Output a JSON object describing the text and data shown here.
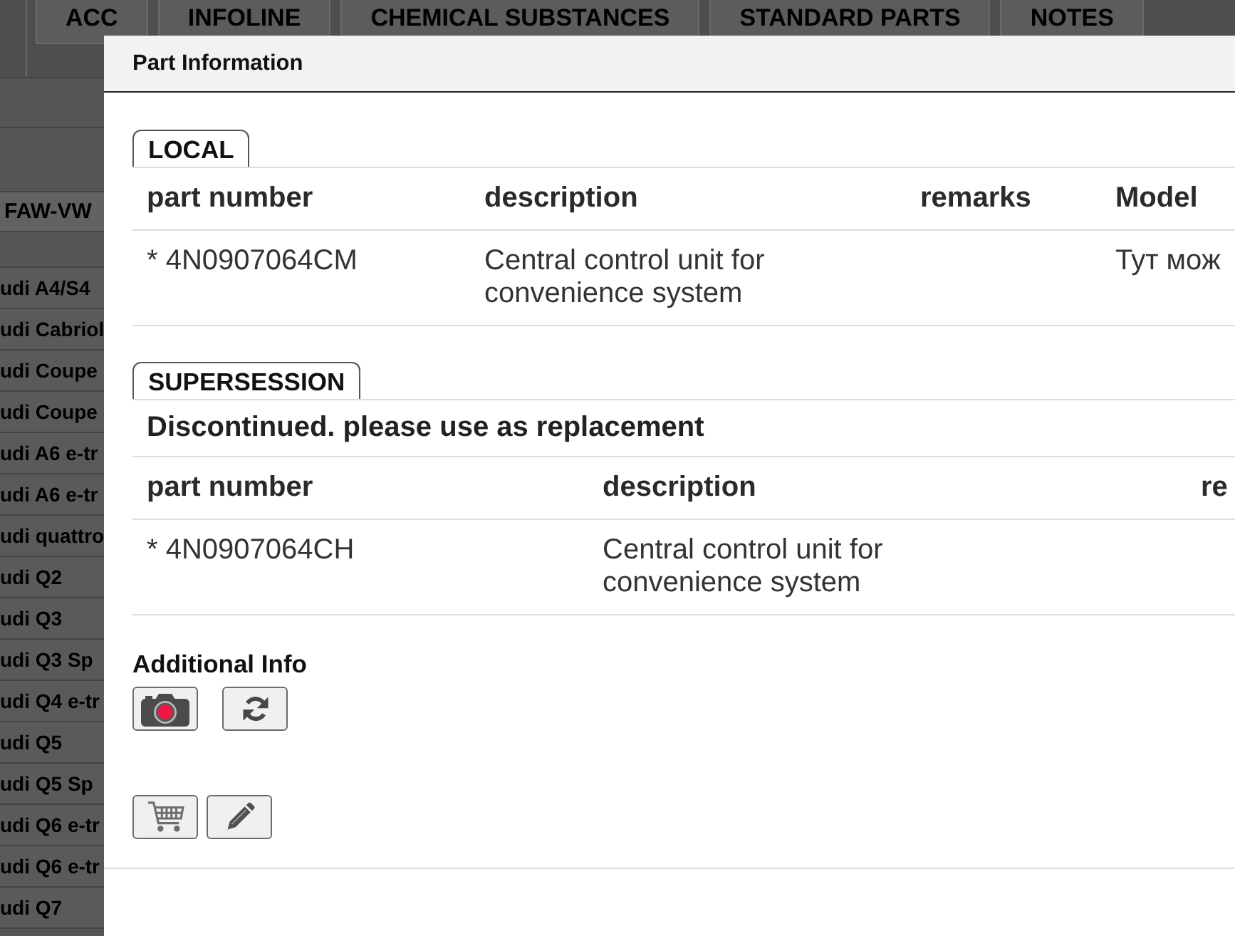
{
  "top_tabs": [
    {
      "label": "ACC",
      "selected": false
    },
    {
      "label": "INFOLINE",
      "selected": false
    },
    {
      "label": "CHEMICAL SUBSTANCES",
      "selected": false
    },
    {
      "label": "STANDARD PARTS",
      "selected": false
    },
    {
      "label": "NOTES",
      "selected": false
    }
  ],
  "sidebar": {
    "header": "FAW-VW",
    "items": [
      "udi A4/S4",
      "udi Cabriol",
      "udi Coupe",
      "udi Coupe",
      "udi A6 e-tr",
      "udi A6 e-tr",
      "udi quattro",
      "udi Q2",
      "udi Q3",
      "udi Q3 Sp",
      "udi Q4 e-tr",
      "udi Q5",
      "udi Q5 Sp",
      "udi Q6 e-tr",
      "udi Q6 e-tr",
      "udi Q7"
    ]
  },
  "dialog": {
    "title": "Part Information",
    "sections": [
      {
        "kind": "local",
        "tab": "LOCAL",
        "columns": [
          "part number",
          "description",
          "remarks",
          "Model"
        ],
        "rows": [
          [
            "* 4N0907064CM",
            "Central control unit for convenience system",
            null,
            "Тут мож"
          ]
        ]
      },
      {
        "kind": "supersession",
        "tab": "SUPERSESSION",
        "message": "Discontinued. please use as replacement",
        "columns": [
          "part number",
          "description",
          "re"
        ],
        "rows": [
          [
            "* 4N0907064CH",
            "Central control unit for convenience system",
            null
          ]
        ]
      }
    ],
    "additional_info": {
      "label": "Additional Info"
    }
  }
}
